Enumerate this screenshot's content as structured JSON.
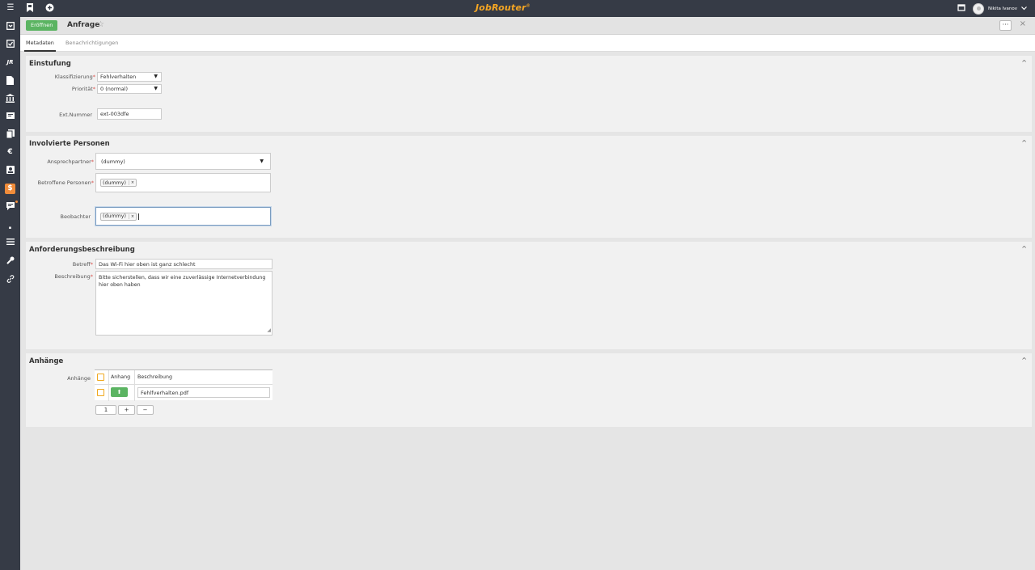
{
  "topbar": {
    "brand": "JobRouter",
    "brand_mark": "®",
    "user_name": "Nikita Ivanov"
  },
  "icons": {
    "menu": "☰",
    "bookmark": "bookmark-icon",
    "add": "plus-circle-icon",
    "calendar": "calendar-icon",
    "chevron": "chevron-down-icon"
  },
  "rail": {
    "items": [
      "inbox-icon",
      "check-box-icon",
      "jr-logo-icon",
      "document-icon",
      "bank-icon",
      "form-icon",
      "copy-icon",
      "euro-icon",
      "contact-icon",
      "dollar-icon",
      "comment-icon",
      "signal-icon",
      "list-icon",
      "wrench-icon",
      "link-icon"
    ],
    "jr_label": "JR",
    "euro_label": "€",
    "dollar_label": "$"
  },
  "header": {
    "open_button": "Eröffnen",
    "title": "Anfrage",
    "star": "☆",
    "more": "···",
    "close": "×"
  },
  "tabs": [
    {
      "label": "Metadaten",
      "active": true
    },
    {
      "label": "Benachrichtigungen",
      "active": false
    }
  ],
  "einstufung": {
    "title": "Einstufung",
    "collapse": "^",
    "klassifizierung_label": "Klassifizierung",
    "klassifizierung_value": "Fehlverhalten",
    "prioritaet_label": "Priorität",
    "prioritaet_value": "0 (normal)",
    "extnummer_label": "Ext.Nummer",
    "extnummer_value": "ext-003dfe",
    "required_mark": "*",
    "caret": "▼"
  },
  "personen": {
    "title": "Involvierte Personen",
    "collapse": "^",
    "ansprechpartner_label": "Ansprechpartner",
    "ansprechpartner_value": "(dummy)",
    "betroffene_label": "Betroffene Personen",
    "betroffene_tag": "(dummy)",
    "beobachter_label": "Beobachter",
    "beobachter_tag": "(dummy)",
    "tag_remove": "×",
    "required_mark": "*",
    "caret": "▼"
  },
  "anforderung": {
    "title": "Anforderungsbeschreibung",
    "collapse": "^",
    "betreff_label": "Betreff",
    "betreff_value": "Das Wi-Fi hier oben ist ganz schlecht",
    "beschreibung_label": "Beschreibung",
    "beschreibung_value": "Bitte sicherstellen, dass wir eine zuverlässige Internetverbindung hier oben haben",
    "required_mark": "*"
  },
  "anhaenge": {
    "title": "Anhänge",
    "collapse": "^",
    "label": "Anhänge",
    "columns": [
      "Anhang",
      "Beschreibung"
    ],
    "rows": [
      {
        "description": "Fehlfverhalten.pdf"
      }
    ],
    "count": "1",
    "add": "+",
    "remove": "−",
    "upload_glyph": "⬆"
  }
}
